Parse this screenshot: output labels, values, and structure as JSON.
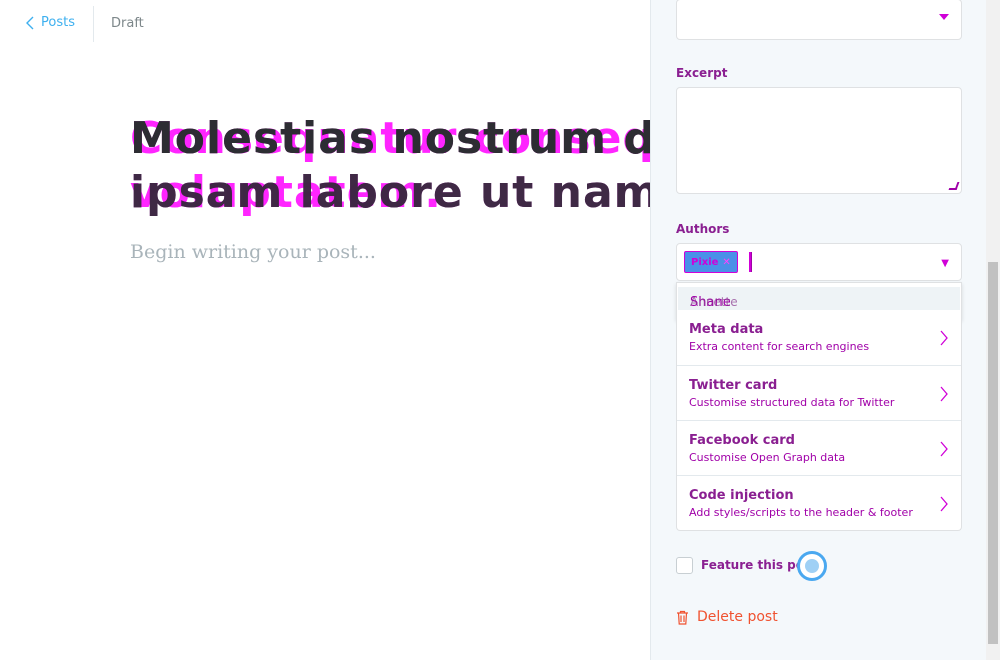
{
  "header": {
    "back_label": "Posts",
    "status": "Draft"
  },
  "editor": {
    "title_line1_a": "Molestias nostrum dolores",
    "title_line2_a": "ipsam labore ut nam qu",
    "title_line1_b": "Consequatur consequuntur",
    "title_line2_b": "voluptatem.",
    "body_placeholder": "Begin writing your post..."
  },
  "sidebar": {
    "excerpt_label": "Excerpt",
    "authors_label": "Authors",
    "author_chip": "Pixie",
    "author_dropdown_option": "Shane",
    "author_dropdown_option_ghost": "Annette",
    "menu": [
      {
        "title": "Meta data",
        "desc": "Extra content for search engines"
      },
      {
        "title": "Twitter card",
        "desc": "Customise structured data for Twitter"
      },
      {
        "title": "Facebook card",
        "desc": "Customise Open Graph data"
      },
      {
        "title": "Code injection",
        "desc": "Add styles/scripts to the header & footer"
      }
    ],
    "feature_label": "Feature this post",
    "delete_label": "Delete post"
  },
  "colors": {
    "accent_blue": "#3eb0ef",
    "delete_red": "#f05230",
    "overlay_purple": "#a000a8",
    "overlay_magenta": "#ff00ff"
  },
  "icons": {
    "back": "chevron-left-icon",
    "select": "caret-down-icon",
    "menu": "chevron-right-icon",
    "delete": "trash-icon"
  }
}
